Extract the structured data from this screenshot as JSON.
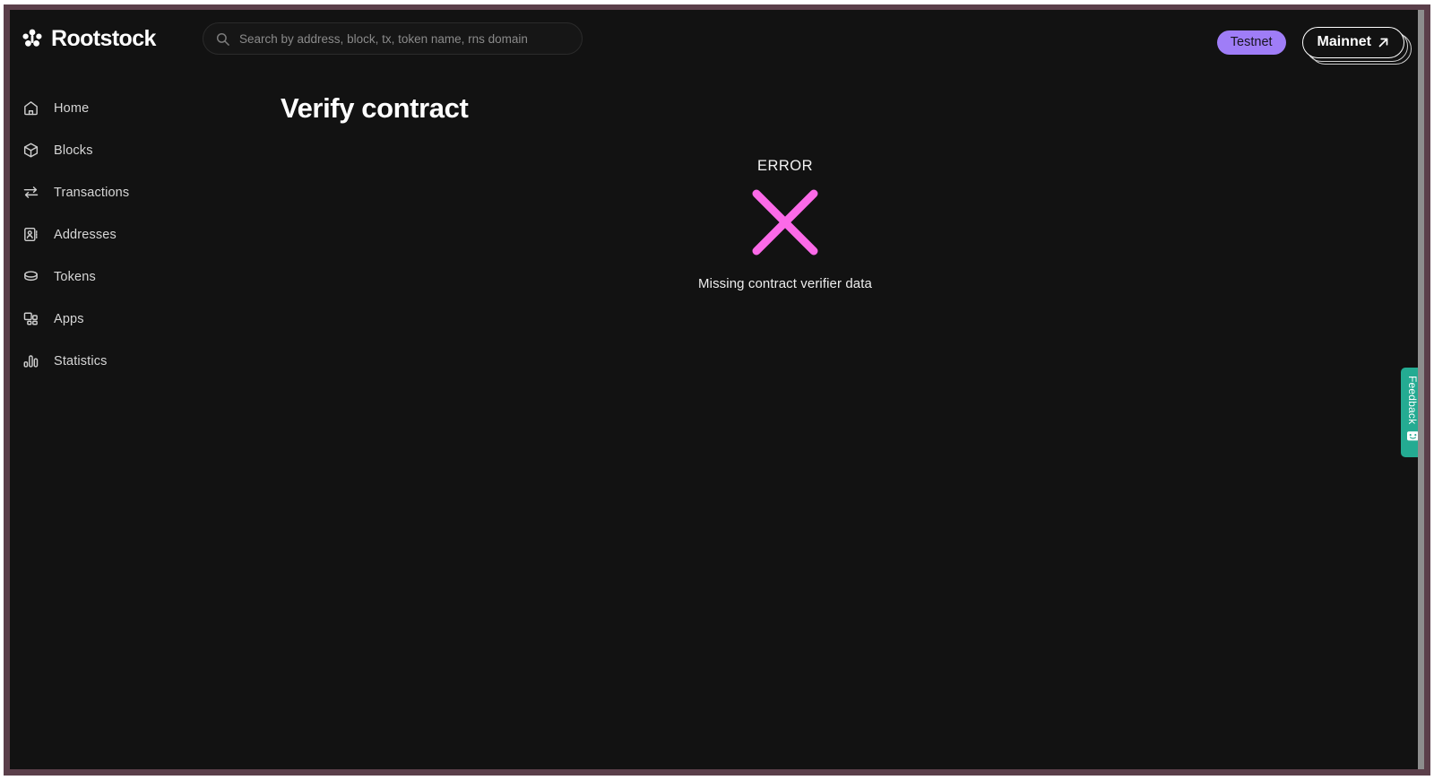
{
  "brand": {
    "name": "Rootstock",
    "logo_icon": "rootstock-cluster-logo"
  },
  "search": {
    "placeholder": "Search by address, block, tx, token name, rns domain",
    "value": "",
    "icon": "search-icon"
  },
  "network": {
    "testnet_label": "Testnet",
    "mainnet_label": "Mainnet",
    "mainnet_icon": "external-link-arrow-icon",
    "testnet_bg": "#9f7df7",
    "testnet_text": "#17141f"
  },
  "sidebar": {
    "items": [
      {
        "label": "Home",
        "icon": "home-icon"
      },
      {
        "label": "Blocks",
        "icon": "cube-icon"
      },
      {
        "label": "Transactions",
        "icon": "swap-arrows-icon"
      },
      {
        "label": "Addresses",
        "icon": "contact-card-icon"
      },
      {
        "label": "Tokens",
        "icon": "coin-icon"
      },
      {
        "label": "Apps",
        "icon": "apps-grid-icon"
      },
      {
        "label": "Statistics",
        "icon": "bar-chart-icon"
      }
    ]
  },
  "main": {
    "page_title": "Verify contract",
    "error": {
      "kicker": "ERROR",
      "icon": "error-x-mark-icon",
      "icon_color": "#fb6ae8",
      "message": "Missing contract verifier data"
    }
  },
  "feedback": {
    "label": "Feedback",
    "icon": "smiling-face-icon",
    "color": "#24ab92"
  },
  "theme": {
    "app_bg": "#121212",
    "frame": "#5b3f4a",
    "text_primary": "#ffffff",
    "text_muted": "#8a8a8a"
  }
}
